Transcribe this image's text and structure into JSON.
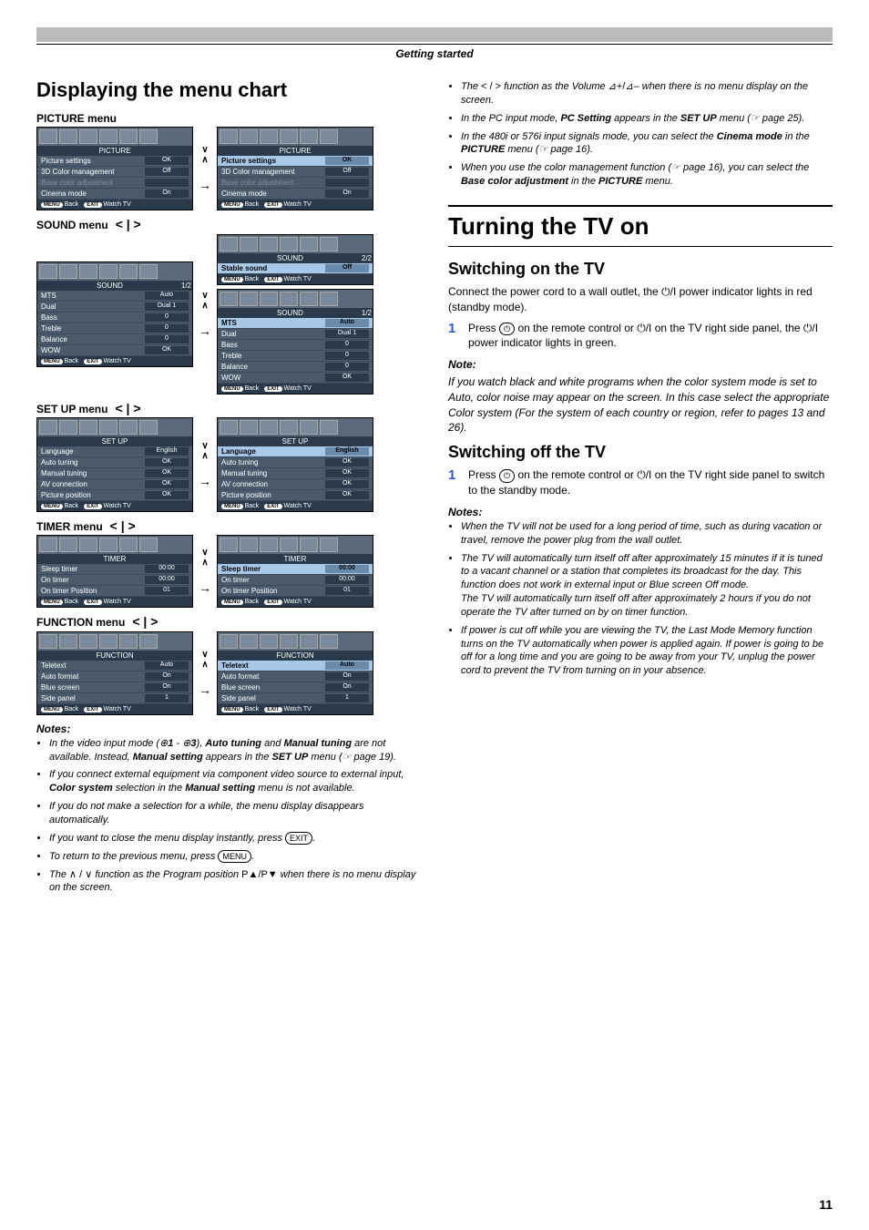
{
  "header": "Getting started",
  "left": {
    "title": "Displaying the menu chart",
    "menus": [
      {
        "label": "PICTURE\nmenu",
        "boxA": {
          "title": "PICTURE",
          "page": "",
          "rows": [
            {
              "k": "Picture settings",
              "v": "OK",
              "hl": false
            },
            {
              "k": "3D Color management",
              "v": "Off",
              "hl": false
            },
            {
              "k": "Base color adjustment",
              "v": "",
              "dim": true
            },
            {
              "k": "Cinema mode",
              "v": "On",
              "hl": false
            }
          ]
        },
        "boxB": {
          "title": "PICTURE",
          "page": "",
          "rows": [
            {
              "k": "Picture settings",
              "v": "OK",
              "hl": true
            },
            {
              "k": "3D Color management",
              "v": "Off"
            },
            {
              "k": "Base color adjustment",
              "v": "",
              "dim": true
            },
            {
              "k": "Cinema mode",
              "v": "On"
            }
          ]
        }
      },
      {
        "label": "SOUND\nmenu",
        "boxA": {
          "title": "SOUND",
          "page": "1/2",
          "rows": [
            {
              "k": "MTS",
              "v": "Auto"
            },
            {
              "k": "Dual",
              "v": "Dual 1"
            },
            {
              "k": "Bass",
              "v": "0"
            },
            {
              "k": "Treble",
              "v": "0"
            },
            {
              "k": "Balance",
              "v": "0"
            },
            {
              "k": "WOW",
              "v": "OK"
            }
          ]
        },
        "extra": {
          "title": "SOUND",
          "page": "2/2",
          "rows": [
            {
              "k": "Stable sound",
              "v": "Off",
              "hl": true
            }
          ]
        },
        "boxB": {
          "title": "SOUND",
          "page": "1/2",
          "rows": [
            {
              "k": "MTS",
              "v": "Auto",
              "hl": true
            },
            {
              "k": "Dual",
              "v": "Dual 1"
            },
            {
              "k": "Bass",
              "v": "0"
            },
            {
              "k": "Treble",
              "v": "0"
            },
            {
              "k": "Balance",
              "v": "0"
            },
            {
              "k": "WOW",
              "v": "OK"
            }
          ]
        }
      },
      {
        "label": "SET UP\nmenu",
        "boxA": {
          "title": "SET UP",
          "page": "",
          "rows": [
            {
              "k": "Language",
              "v": "English"
            },
            {
              "k": "Auto tuning",
              "v": "OK"
            },
            {
              "k": "Manual tuning",
              "v": "OK"
            },
            {
              "k": "AV connection",
              "v": "OK"
            },
            {
              "k": "Picture position",
              "v": "OK"
            }
          ]
        },
        "boxB": {
          "title": "SET UP",
          "page": "",
          "rows": [
            {
              "k": "Language",
              "v": "English",
              "hl": true
            },
            {
              "k": "Auto tuning",
              "v": "OK"
            },
            {
              "k": "Manual tuning",
              "v": "OK"
            },
            {
              "k": "AV connection",
              "v": "OK"
            },
            {
              "k": "Picture position",
              "v": "OK"
            }
          ]
        }
      },
      {
        "label": "TIMER\nmenu",
        "boxA": {
          "title": "TIMER",
          "page": "",
          "rows": [
            {
              "k": "Sleep timer",
              "v": "00:00"
            },
            {
              "k": "On timer",
              "v": "00:00"
            },
            {
              "k": "On timer Position",
              "v": "01"
            }
          ]
        },
        "boxB": {
          "title": "TIMER",
          "page": "",
          "rows": [
            {
              "k": "Sleep timer",
              "v": "00:00",
              "hl": true
            },
            {
              "k": "On timer",
              "v": "00:00"
            },
            {
              "k": "On timer Position",
              "v": "01"
            }
          ]
        }
      },
      {
        "label": "FUNCTION\nmenu",
        "boxA": {
          "title": "FUNCTION",
          "page": "",
          "rows": [
            {
              "k": "Teletext",
              "v": "Auto"
            },
            {
              "k": "Auto format",
              "v": "On"
            },
            {
              "k": "Blue screen",
              "v": "On"
            },
            {
              "k": "Side panel",
              "v": "1"
            }
          ]
        },
        "boxB": {
          "title": "FUNCTION",
          "page": "",
          "rows": [
            {
              "k": "Teletext",
              "v": "Auto",
              "hl": true
            },
            {
              "k": "Auto format",
              "v": "On"
            },
            {
              "k": "Blue screen",
              "v": "On"
            },
            {
              "k": "Side panel",
              "v": "1"
            }
          ]
        }
      }
    ],
    "foot": {
      "back": "MENU",
      "backLabel": "Back",
      "exit": "EXIT",
      "exitLabel": "Watch TV"
    },
    "notesTitle": "Notes:",
    "notes": [
      "In the video input mode (⊕<b>1</b> - ⊕<b>3</b>), <b>Auto tuning</b> and <b>Manual tuning</b> are not available. Instead, <b>Manual setting</b> appears in the <b>SET UP</b> menu (☞ page 19).",
      "If you connect external equipment via component video source to external input, <b>Color system</b> selection in the <b>Manual setting</b> menu is not available.",
      "If you do not make a selection for a while, the menu display disappears automatically.",
      "If you want to close the menu display instantly, press <span class='pill'>EXIT</span>.",
      "To return to the previous menu, press <span class='pill'>MENU</span>.",
      "The <span class='sym'>∧ / ∨</span> function as the Program position <span class='sym'>P▲/P▼</span> when there is no menu display on the screen."
    ]
  },
  "right": {
    "notesCont": [
      "The <span class='sym'>&lt; / &gt;</span> function as the Volume <span class='sym'>⊿+/⊿–</span> when there is no menu display on the screen.",
      "In the PC input mode, <b>PC Setting</b> appears in the <b>SET UP</b> menu (☞ page 25).",
      "In the 480i or 576i input signals mode, you can select the <b>Cinema mode</b> in the <b>PICTURE</b> menu (☞ page 16).",
      "When you use the color management function (☞ page 16), you can select the <b>Base color adjustment</b> in the <b>PICTURE</b> menu."
    ],
    "h1": "Turning the TV on",
    "s1": {
      "h": "Switching on the TV",
      "p": "Connect the power cord to a wall outlet, the ⏻/I power indicator lights in red (standby mode).",
      "step": {
        "n": "1",
        "t": "Press <span class='pill'>⏻</span> on the remote control or ⏻/I on the TV right side panel, the ⏻/I power indicator lights in green."
      },
      "noteH": "Note:",
      "note": "If you watch black and white programs when the color system mode is set to Auto, color noise may appear on the screen. In this case select the appropriate Color system (For the system of each country or region, refer to pages 13 and 26)."
    },
    "s2": {
      "h": "Switching off the TV",
      "step": {
        "n": "1",
        "t": "Press <span class='pill'>⏻</span> on the remote control or ⏻/I on the TV right side panel to switch to the standby mode."
      },
      "notesH": "Notes:",
      "notes": [
        "When the TV will not be used for a long period of time, such as during vacation or travel, remove the power plug from the wall outlet.",
        "The TV will automatically turn itself off after approximately 15 minutes if it is tuned to a vacant channel or a station that completes its broadcast for the day. This function does not work in external input or Blue screen Off mode.<br>The TV will automatically turn itself off after approximately 2 hours if you do not operate the TV after turned on by on timer function.",
        "If power is cut off while you are viewing the TV, the Last Mode Memory function turns on the TV automatically when power is applied again. If power is going to be off for a long time and you are going to be away from your TV, unplug the power cord to prevent the TV from turning on in your absence."
      ]
    }
  },
  "pageNum": "11"
}
